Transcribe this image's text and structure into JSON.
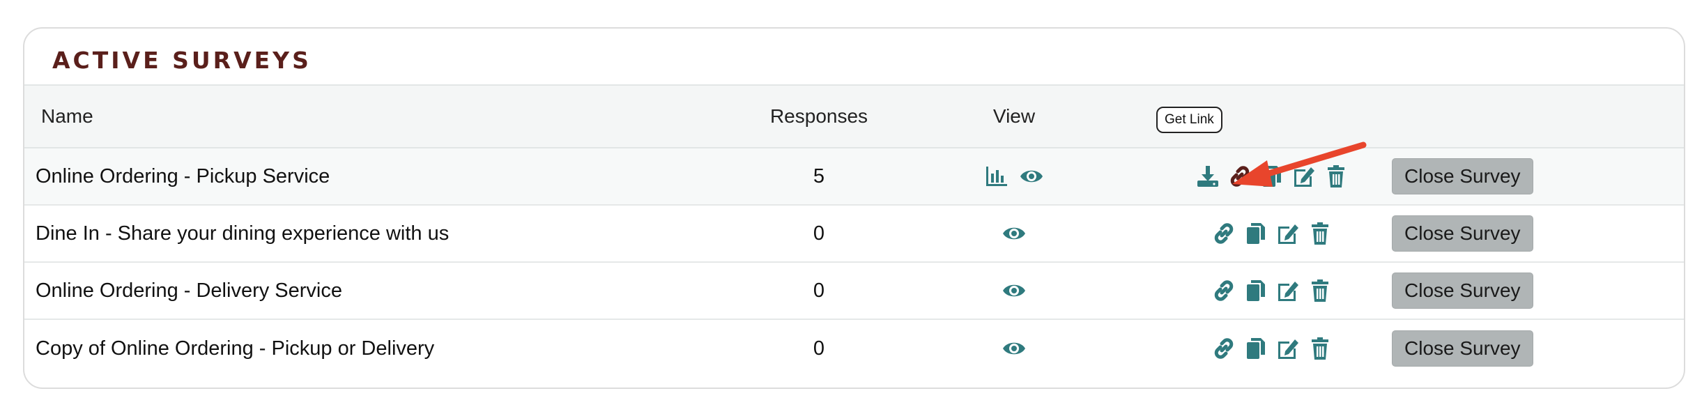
{
  "panel": {
    "title": "Active Surveys"
  },
  "columns": {
    "name": "Name",
    "responses": "Responses",
    "view": "View"
  },
  "rows": [
    {
      "name": "Online Ordering - Pickup Service",
      "responses": "5",
      "close_label": "Close Survey",
      "has_stats": true
    },
    {
      "name": "Dine In - Share your dining experience with us",
      "responses": "0",
      "close_label": "Close Survey",
      "has_stats": false
    },
    {
      "name": "Online Ordering - Delivery Service",
      "responses": "0",
      "close_label": "Close Survey",
      "has_stats": false
    },
    {
      "name": "Copy of Online Ordering - Pickup or Delivery",
      "responses": "0",
      "close_label": "Close Survey",
      "has_stats": false
    }
  ],
  "tooltip": {
    "text": "Get Link"
  },
  "icons": {
    "chart": "bar-chart-icon",
    "view": "eye-icon",
    "download": "download-icon",
    "link": "link-icon",
    "copy": "copy-icon",
    "edit": "edit-icon",
    "delete": "trash-icon"
  },
  "colors": {
    "icon_teal": "#2f7a7e",
    "link_active": "#5a1f1b",
    "title": "#5a1f1b",
    "arrow": "#e8452c",
    "button_bg": "#b0b5b6"
  }
}
